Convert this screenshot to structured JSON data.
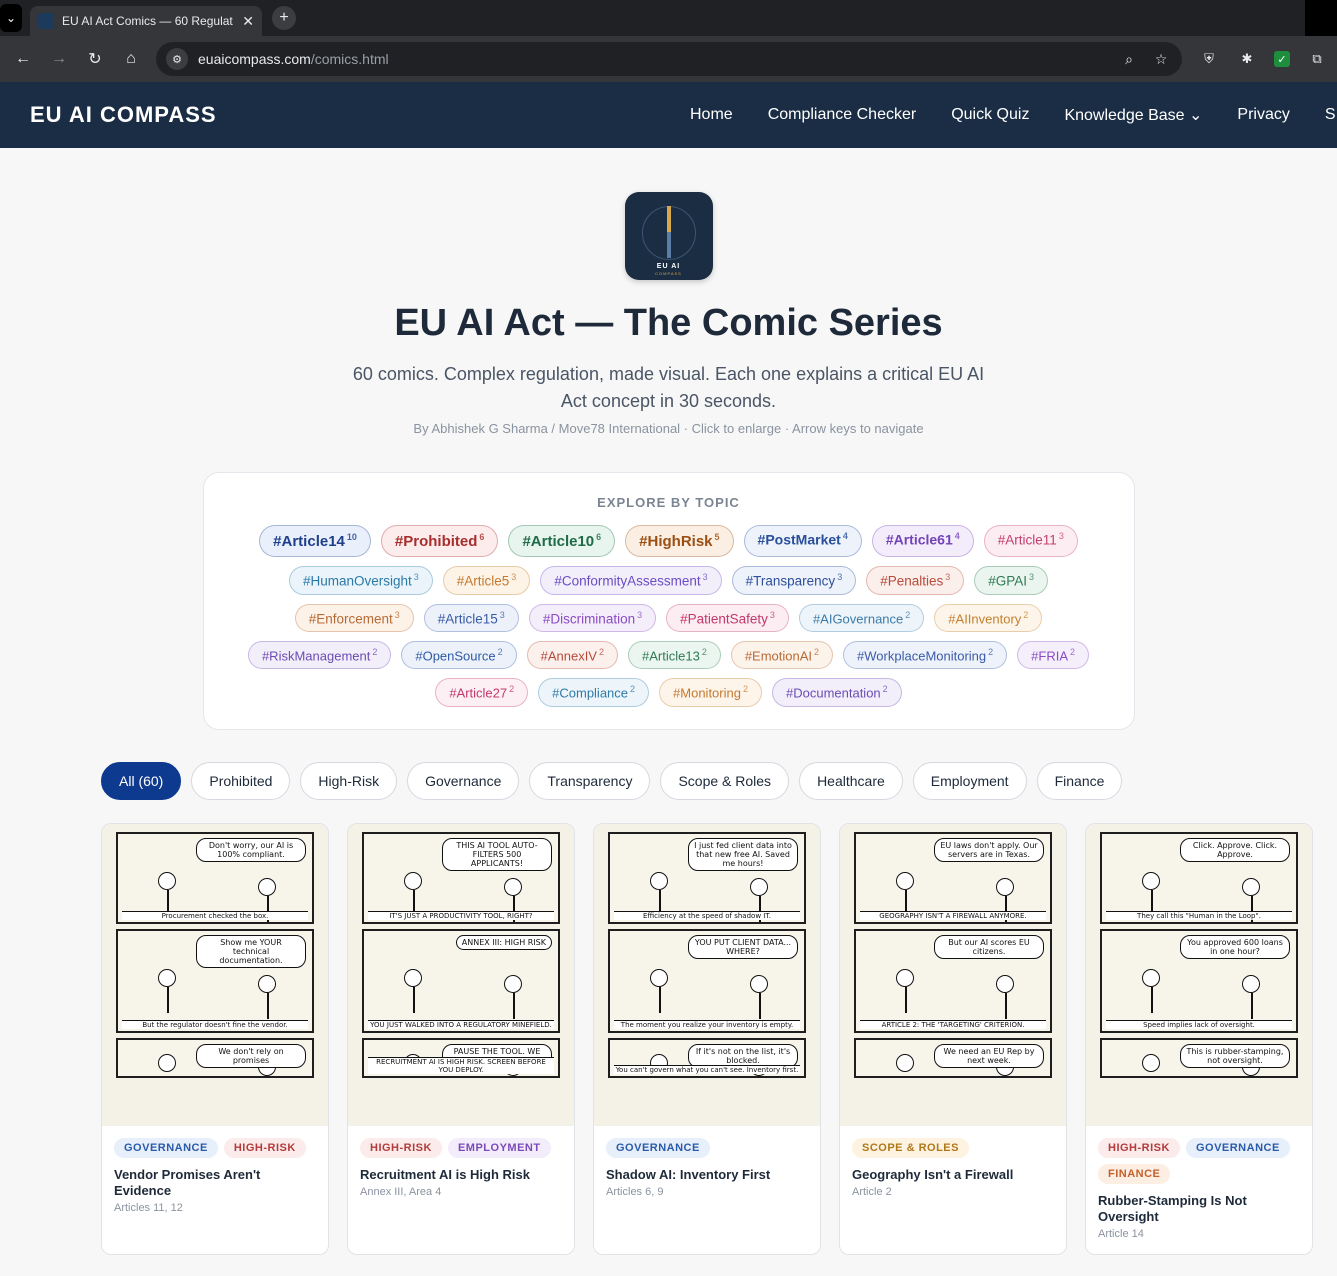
{
  "browser": {
    "tab_title": "EU AI Act Comics — 60 Regulat",
    "url_host": "euaicompass.com",
    "url_path": "/comics.html"
  },
  "site": {
    "brand": "EU AI COMPASS",
    "nav": [
      "Home",
      "Compliance Checker",
      "Quick Quiz",
      "Knowledge Base ⌄",
      "Privacy",
      "S"
    ]
  },
  "hero": {
    "logo_text": "EU AI",
    "logo_sub": "COMPASS",
    "title": "EU AI Act — The Comic Series",
    "subtitle": "60 comics. Complex regulation, made visual. Each one explains a critical EU AI Act concept in 30 seconds.",
    "byline": "By Abhishek G Sharma / Move78 International · Click to enlarge · Arrow keys to navigate"
  },
  "topics": {
    "heading": "EXPLORE BY TOPIC",
    "tags": [
      {
        "label": "#Article14",
        "count": "10",
        "color": "#1e3f8a",
        "bg": "#eaf0fb",
        "size": "lg"
      },
      {
        "label": "#Prohibited",
        "count": "6",
        "color": "#a82e2e",
        "bg": "#fcecec",
        "size": "lg"
      },
      {
        "label": "#Article10",
        "count": "6",
        "color": "#1f6b48",
        "bg": "#e8f5ee",
        "size": "lg"
      },
      {
        "label": "#HighRisk",
        "count": "5",
        "color": "#9a4f15",
        "bg": "#fbefe3",
        "size": "lg"
      },
      {
        "label": "#PostMarket",
        "count": "4",
        "color": "#2a4f9a",
        "bg": "#edf2fb",
        "size": "md"
      },
      {
        "label": "#Article61",
        "count": "4",
        "color": "#7442b8",
        "bg": "#f3edfb",
        "size": "md"
      },
      {
        "label": "#Article11",
        "count": "3",
        "color": "#c23f6e",
        "bg": "#fcedf2",
        "size": "sm"
      },
      {
        "label": "#HumanOversight",
        "count": "3",
        "color": "#2a7aa8",
        "bg": "#eaf4fa",
        "size": "sm"
      },
      {
        "label": "#Article5",
        "count": "3",
        "color": "#c47a30",
        "bg": "#fdf3e6",
        "size": "sm"
      },
      {
        "label": "#ConformityAssessment",
        "count": "3",
        "color": "#6b4cc4",
        "bg": "#f2effb",
        "size": "sm"
      },
      {
        "label": "#Transparency",
        "count": "3",
        "color": "#2e4f9a",
        "bg": "#eef2fb",
        "size": "sm"
      },
      {
        "label": "#Penalties",
        "count": "3",
        "color": "#b84a3a",
        "bg": "#fbefec",
        "size": "sm"
      },
      {
        "label": "#GPAI",
        "count": "3",
        "color": "#2e7a52",
        "bg": "#eaf5ef",
        "size": "sm"
      },
      {
        "label": "#Enforcement",
        "count": "3",
        "color": "#b86a35",
        "bg": "#fcf2e8",
        "size": "sm"
      },
      {
        "label": "#Article15",
        "count": "3",
        "color": "#3a5ba8",
        "bg": "#edf1fa",
        "size": "sm"
      },
      {
        "label": "#Discrimination",
        "count": "3",
        "color": "#8a4cc4",
        "bg": "#f4eefb",
        "size": "sm"
      },
      {
        "label": "#PatientSafety",
        "count": "3",
        "color": "#c2386a",
        "bg": "#fcedf2",
        "size": "sm"
      },
      {
        "label": "#AIGovernance",
        "count": "2",
        "color": "#3c7aa8",
        "bg": "#edf5fa",
        "size": "xs"
      },
      {
        "label": "#AIInventory",
        "count": "2",
        "color": "#c4802e",
        "bg": "#fdf5ea",
        "size": "xs"
      },
      {
        "label": "#RiskManagement",
        "count": "2",
        "color": "#6a4cb4",
        "bg": "#f3effa",
        "size": "xs"
      },
      {
        "label": "#OpenSource",
        "count": "2",
        "color": "#2e5aa8",
        "bg": "#edf2fa",
        "size": "xs"
      },
      {
        "label": "#AnnexIV",
        "count": "2",
        "color": "#b84a3a",
        "bg": "#fbf0ec",
        "size": "xs"
      },
      {
        "label": "#Article13",
        "count": "2",
        "color": "#2e7a52",
        "bg": "#ecf6f0",
        "size": "xs"
      },
      {
        "label": "#EmotionAI",
        "count": "2",
        "color": "#b86a35",
        "bg": "#fcf3ea",
        "size": "xs"
      },
      {
        "label": "#WorkplaceMonitoring",
        "count": "2",
        "color": "#3a5ba8",
        "bg": "#eef2fa",
        "size": "xs"
      },
      {
        "label": "#FRIA",
        "count": "2",
        "color": "#8a4cc4",
        "bg": "#f5effb",
        "size": "xs"
      },
      {
        "label": "#Article27",
        "count": "2",
        "color": "#c2386a",
        "bg": "#fcf0f4",
        "size": "xs"
      },
      {
        "label": "#Compliance",
        "count": "2",
        "color": "#2e7aa8",
        "bg": "#edf5fa",
        "size": "xs"
      },
      {
        "label": "#Monitoring",
        "count": "2",
        "color": "#c47a30",
        "bg": "#fdf5ea",
        "size": "xs"
      },
      {
        "label": "#Documentation",
        "count": "2",
        "color": "#6a4cb4",
        "bg": "#f3effa",
        "size": "xs"
      }
    ]
  },
  "filters": [
    "All (60)",
    "Prohibited",
    "High-Risk",
    "Governance",
    "Transparency",
    "Scope & Roles",
    "Healthcare",
    "Employment",
    "Finance"
  ],
  "cards": [
    {
      "badges": [
        {
          "text": "GOVERNANCE",
          "kind": "gov"
        },
        {
          "text": "HIGH-RISK",
          "kind": "hr"
        }
      ],
      "title": "Vendor Promises Aren't Evidence",
      "meta": "Articles 11, 12",
      "panels": [
        {
          "bubble": "Don't worry, our AI is 100% compliant.",
          "caption": "Procurement checked the box."
        },
        {
          "bubble": "Show me YOUR technical documentation.",
          "caption": "But the regulator doesn't fine the vendor."
        },
        {
          "bubble": "We don't rely on promises",
          "caption": ""
        }
      ]
    },
    {
      "badges": [
        {
          "text": "HIGH-RISK",
          "kind": "hr"
        },
        {
          "text": "EMPLOYMENT",
          "kind": "emp"
        }
      ],
      "title": "Recruitment AI is High Risk",
      "meta": "Annex III, Area 4",
      "panels": [
        {
          "bubble": "THIS AI TOOL AUTO-FILTERS 500 APPLICANTS!",
          "caption": "IT'S JUST A PRODUCTIVITY TOOL, RIGHT?"
        },
        {
          "bubble": "ANNEX III: HIGH RISK",
          "caption": "YOU JUST WALKED INTO A REGULATORY MINEFIELD."
        },
        {
          "bubble": "PAUSE THE TOOL. WE CLASSIFY FIRST.",
          "caption": "RECRUITMENT AI IS HIGH RISK. SCREEN BEFORE YOU DEPLOY."
        }
      ]
    },
    {
      "badges": [
        {
          "text": "GOVERNANCE",
          "kind": "gov"
        }
      ],
      "title": "Shadow AI: Inventory First",
      "meta": "Articles 6, 9",
      "panels": [
        {
          "bubble": "I just fed client data into that new free AI. Saved me hours!",
          "caption": "Efficiency at the speed of shadow IT."
        },
        {
          "bubble": "YOU PUT CLIENT DATA... WHERE?",
          "caption": "The moment you realize your inventory is empty."
        },
        {
          "bubble": "If it's not on the list, it's blocked.",
          "caption": "You can't govern what you can't see. Inventory first."
        }
      ]
    },
    {
      "badges": [
        {
          "text": "SCOPE & ROLES",
          "kind": "scope"
        }
      ],
      "title": "Geography Isn't a Firewall",
      "meta": "Article 2",
      "panels": [
        {
          "bubble": "EU laws don't apply. Our servers are in Texas.",
          "caption": "GEOGRAPHY ISN'T A FIREWALL ANYMORE."
        },
        {
          "bubble": "But our AI scores EU citizens.",
          "caption": "ARTICLE 2: THE 'TARGETING' CRITERION."
        },
        {
          "bubble": "We need an EU Rep by next week.",
          "caption": ""
        }
      ]
    },
    {
      "badges": [
        {
          "text": "HIGH-RISK",
          "kind": "hr"
        },
        {
          "text": "GOVERNANCE",
          "kind": "gov"
        },
        {
          "text": "FINANCE",
          "kind": "fin"
        }
      ],
      "title": "Rubber-Stamping Is Not Oversight",
      "meta": "Article 14",
      "panels": [
        {
          "bubble": "Click. Approve. Click. Approve.",
          "caption": "They call this \"Human in the Loop\"."
        },
        {
          "bubble": "You approved 600 loans in one hour?",
          "caption": "Speed implies lack of oversight."
        },
        {
          "bubble": "This is rubber-stamping, not oversight.",
          "caption": ""
        }
      ]
    }
  ]
}
